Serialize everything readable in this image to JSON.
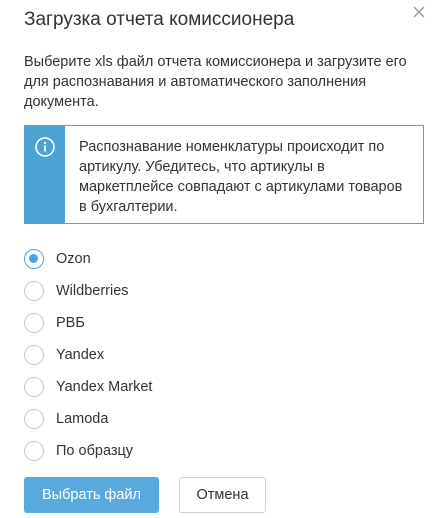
{
  "dialog": {
    "title": "Загрузка отчета комиссионера",
    "close_icon": "close-icon",
    "description": "Выберите xls файл отчета комиссионера и загрузите его для распознавания и автоматического заполнения документа."
  },
  "info": {
    "icon": "info-icon",
    "text": "Распознавание номенклатуры происходит по артикулу. Убедитесь, что артикулы в маркетплейсе совпадают с артикулами товаров в бухгалтерии.",
    "accent_color": "#4da3d4"
  },
  "marketplaces": {
    "selected": "Ozon",
    "options": [
      {
        "label": "Ozon",
        "checked": true
      },
      {
        "label": "Wildberries",
        "checked": false
      },
      {
        "label": "РВБ",
        "checked": false
      },
      {
        "label": "Yandex",
        "checked": false
      },
      {
        "label": "Yandex Market",
        "checked": false
      },
      {
        "label": "Lamoda",
        "checked": false
      },
      {
        "label": "По образцу",
        "checked": false
      }
    ]
  },
  "buttons": {
    "choose_file": "Выбрать файл",
    "cancel": "Отмена",
    "primary_color": "#5aa9dd"
  }
}
